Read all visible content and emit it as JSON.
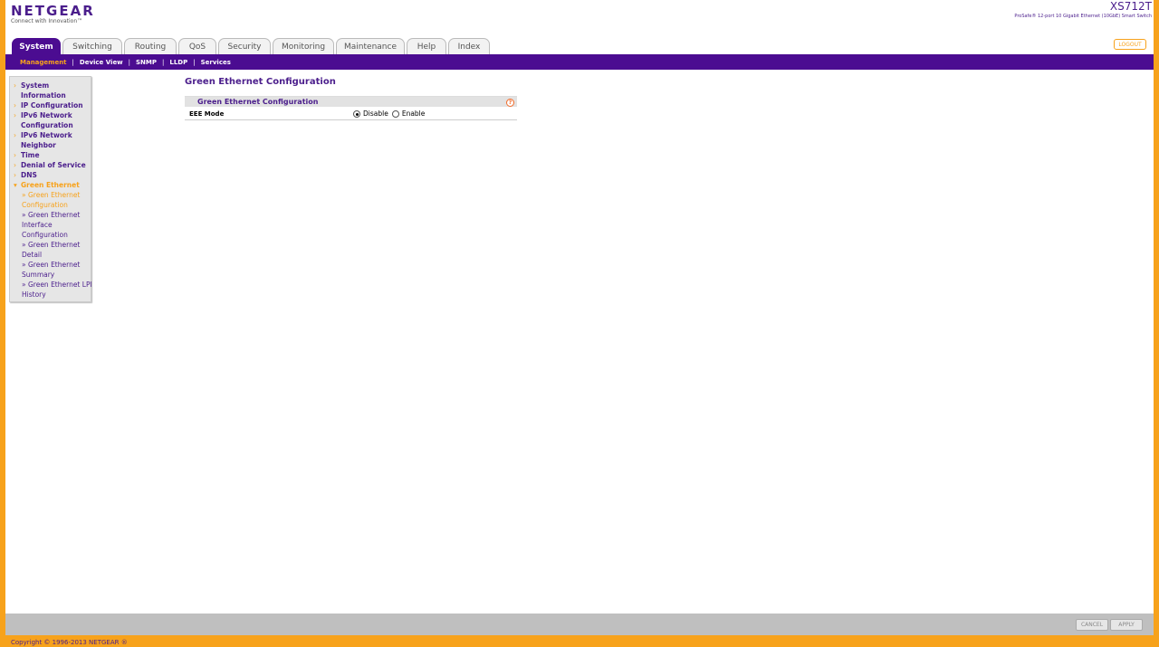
{
  "brand": {
    "logo": "NETGEAR",
    "tagline": "Connect with Innovation™",
    "model": "XS712T",
    "model_desc": "ProSafe® 12-port 10 Gigabit Ethernet (10GbE) Smart Switch",
    "logout": "LOGOUT"
  },
  "tabs": [
    {
      "label": "System"
    },
    {
      "label": "Switching"
    },
    {
      "label": "Routing"
    },
    {
      "label": "QoS"
    },
    {
      "label": "Security"
    },
    {
      "label": "Monitoring"
    },
    {
      "label": "Maintenance"
    },
    {
      "label": "Help"
    },
    {
      "label": "Index"
    }
  ],
  "subnav": [
    {
      "label": "Management"
    },
    {
      "label": "Device View"
    },
    {
      "label": "SNMP"
    },
    {
      "label": "LLDP"
    },
    {
      "label": "Services"
    }
  ],
  "sidebar": {
    "links": [
      {
        "label": "System Information"
      },
      {
        "label": "IP Configuration"
      },
      {
        "label": "IPv6 Network Configuration"
      },
      {
        "label": "IPv6 Network Neighbor"
      },
      {
        "label": "Time"
      },
      {
        "label": "Denial of Service"
      },
      {
        "label": "DNS"
      },
      {
        "label": "Green Ethernet"
      }
    ],
    "subs": [
      {
        "label": "» Green Ethernet Configuration"
      },
      {
        "label": "» Green Ethernet Interface Configuration"
      },
      {
        "label": "» Green Ethernet Detail"
      },
      {
        "label": "» Green Ethernet Summary"
      },
      {
        "label": "» Green Ethernet LPI History"
      }
    ]
  },
  "main": {
    "title": "Green Ethernet Configuration",
    "panel_title": "Green Ethernet Configuration",
    "help_glyph": "?",
    "eee_label": "EEE Mode",
    "options": [
      "Disable",
      "Enable"
    ],
    "selected": "Disable"
  },
  "footer": {
    "cancel": "CANCEL",
    "apply": "APPLY",
    "copyright": "Copyright © 1996-2013 NETGEAR ®"
  },
  "colors": {
    "purple": "#4b0c91",
    "orange": "#f7a21b"
  }
}
